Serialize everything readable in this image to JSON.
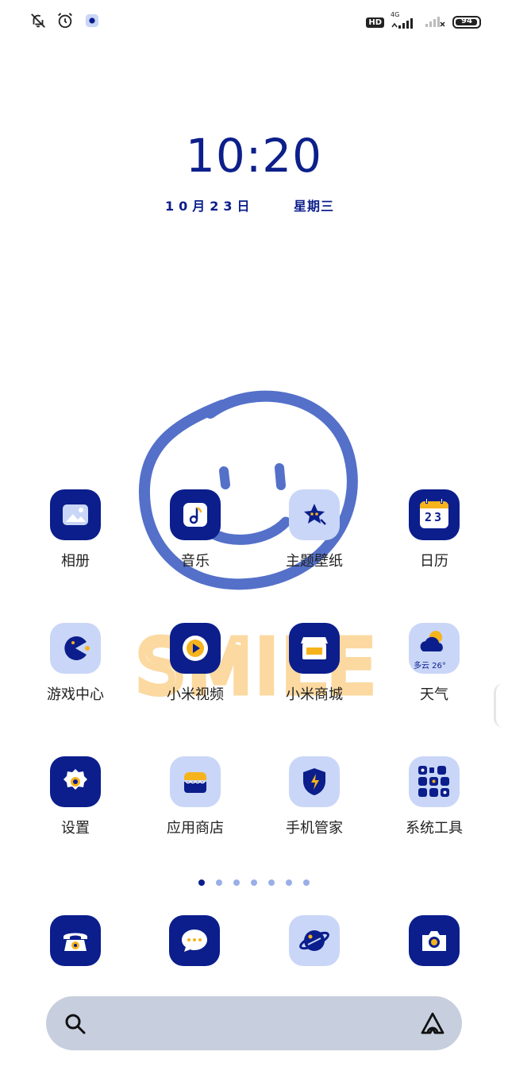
{
  "status_bar": {
    "left_icons": [
      "muted-bell-icon",
      "alarm-clock-icon",
      "app-notification-icon"
    ],
    "network": "4G",
    "hd_label": "HD",
    "battery_level": "94"
  },
  "clock": {
    "time": "10:20",
    "date": "10月23日",
    "weekday": "星期三"
  },
  "wallpaper": {
    "smile_text": "SMILE",
    "accent_color": "#5470c9",
    "text_color": "#fbd9a0"
  },
  "apps": [
    {
      "label": "相册",
      "icon": "gallery-icon"
    },
    {
      "label": "音乐",
      "icon": "music-icon"
    },
    {
      "label": "主题壁纸",
      "icon": "themes-icon"
    },
    {
      "label": "日历",
      "icon": "calendar-icon",
      "calendar_day": "23"
    },
    {
      "label": "游戏中心",
      "icon": "game-center-icon"
    },
    {
      "label": "小米视频",
      "icon": "video-icon"
    },
    {
      "label": "小米商城",
      "icon": "mi-store-icon"
    },
    {
      "label": "天气",
      "icon": "weather-icon",
      "weather_text": "多云 26°"
    },
    {
      "label": "设置",
      "icon": "settings-icon"
    },
    {
      "label": "应用商店",
      "icon": "app-store-icon"
    },
    {
      "label": "手机管家",
      "icon": "security-icon"
    },
    {
      "label": "系统工具",
      "icon": "system-tools-folder-icon"
    }
  ],
  "page_indicator": {
    "count": 7,
    "active": 0
  },
  "dock": [
    {
      "icon": "phone-icon"
    },
    {
      "icon": "messages-icon"
    },
    {
      "icon": "browser-icon"
    },
    {
      "icon": "camera-icon"
    }
  ],
  "colors": {
    "primary": "#0b1e8c",
    "light_tile": "#c9d6f7",
    "accent_yellow": "#f6b31c",
    "search_bg": "#c7cede"
  }
}
